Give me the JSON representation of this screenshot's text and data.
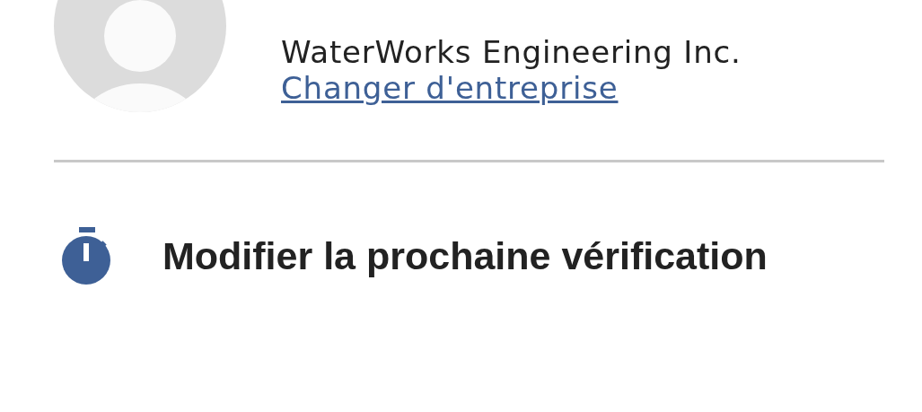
{
  "profile": {
    "company": "WaterWorks Engineering Inc.",
    "change_company_link": "Changer d'entreprise"
  },
  "actions": [
    {
      "label": "Modifier la prochaine vérification",
      "kind": "timer"
    }
  ]
}
